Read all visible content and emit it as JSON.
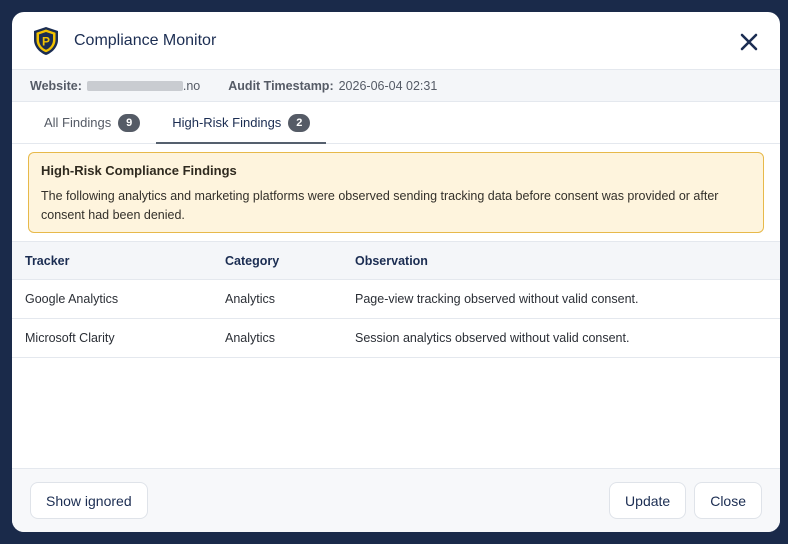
{
  "header": {
    "title": "Compliance Monitor",
    "logo_letter": "P"
  },
  "meta": {
    "website_label": "Website:",
    "website_suffix": ".no",
    "audit_label": "Audit Timestamp:",
    "audit_value": "2026-06-04 02:31"
  },
  "tabs": [
    {
      "label": "All Findings",
      "count": "9"
    },
    {
      "label": "High-Risk Findings",
      "count": "2"
    }
  ],
  "alert": {
    "title": "High-Risk Compliance Findings",
    "text": "The following analytics and marketing platforms were observed sending tracking data before consent was provided or after consent had been denied."
  },
  "table": {
    "headers": [
      "Tracker",
      "Category",
      "Observation"
    ],
    "rows": [
      [
        "Google Analytics",
        "Analytics",
        "Page-view tracking observed without valid consent."
      ],
      [
        "Microsoft Clarity",
        "Analytics",
        "Session analytics observed without valid consent."
      ]
    ]
  },
  "footer": {
    "show_ignored": "Show ignored",
    "update": "Update",
    "close": "Close"
  },
  "colors": {
    "accent": "#1b2d52",
    "alert_border": "#e7b94a",
    "alert_bg": "#fef4dd",
    "logo_gold": "#f2c200"
  }
}
